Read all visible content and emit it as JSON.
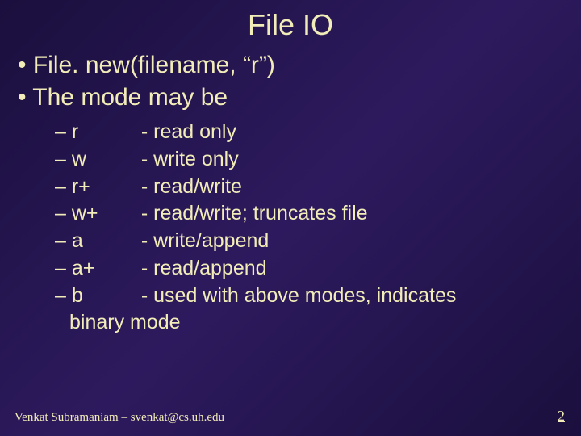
{
  "title": "File IO",
  "bullets": [
    "File. new(filename, “r”)",
    "The mode may be"
  ],
  "modes": [
    {
      "key": "r",
      "desc": "- read only"
    },
    {
      "key": "w",
      "desc": "- write only"
    },
    {
      "key": "r+",
      "desc": "- read/write"
    },
    {
      "key": "w+",
      "desc": "- read/write; truncates file"
    },
    {
      "key": "a",
      "desc": "- write/append"
    },
    {
      "key": "a+",
      "desc": "- read/append"
    },
    {
      "key": "b",
      "desc": "- used with above modes, indicates"
    }
  ],
  "mode_cont": "binary mode",
  "footer": "Venkat Subramaniam – svenkat@cs.uh.edu",
  "page": "2"
}
